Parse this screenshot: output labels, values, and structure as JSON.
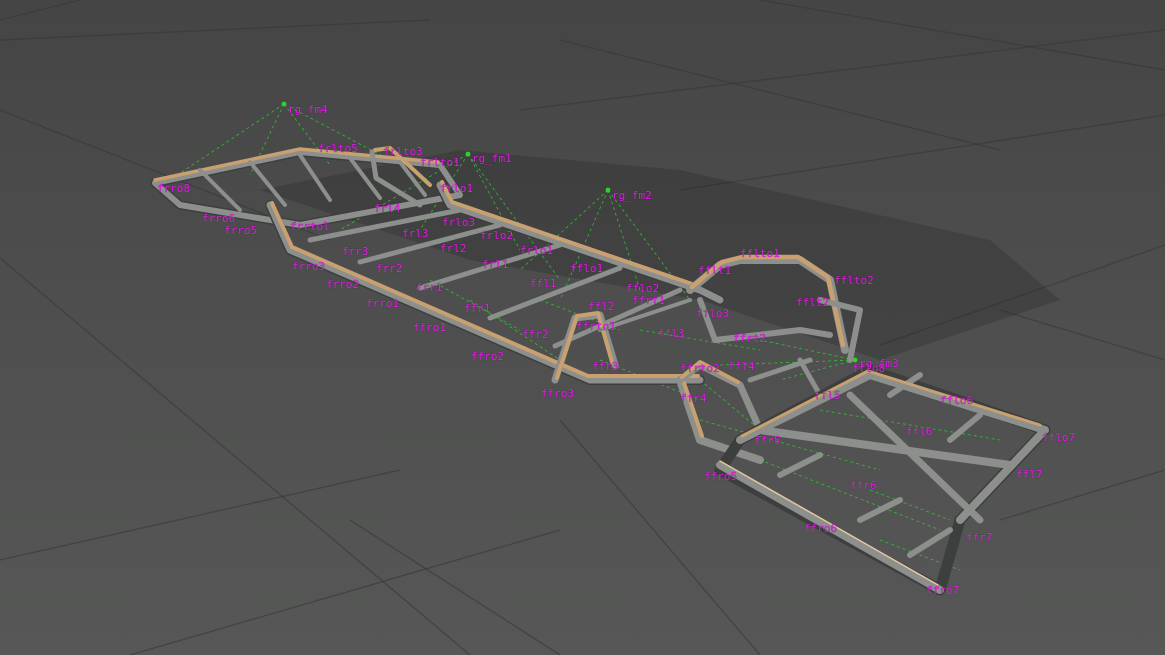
{
  "scene": {
    "colors": {
      "ground": "#4a4b4a",
      "label": "#e11ee6",
      "wire": "#2fd22f",
      "beam_orange": "#c9a070",
      "beam_grey": "#8c8f8c"
    }
  },
  "nodes": {
    "rg_fm4": "rg_fm4",
    "rg_fm1": "rg_fm1",
    "rg_fm2": "rg_fm2",
    "rg_fm3": "rg_fm3",
    "frlto5": "frlto5",
    "frlto3": "frlto3",
    "frlto1": "frlto1",
    "frlo1": "frlo1",
    "frlo3": "frlo3",
    "frlo2": "frlo2",
    "frlo1b": "frlo1",
    "frl1": "frl1",
    "frl2": "frl2",
    "frl3": "frl3",
    "frl4": "frl4",
    "frr1": "frr1",
    "frr2": "frr2",
    "frr3": "frr3",
    "frro1": "frro1",
    "frro2": "frro2",
    "frro3": "frro3",
    "frro5": "frro5",
    "frro6": "frro6",
    "frro8": "frro8",
    "frrtol": "frrtol",
    "ffrr1": "ffr1",
    "ffr2": "ffr2",
    "ffr3": "ffr3",
    "ffr4": "ffr4",
    "ffr5": "ffr5",
    "ffr6": "ffr6",
    "ffr7": "ffr7",
    "ffro1": "ffro1",
    "ffro2": "ffro2",
    "ffro3": "ffro3",
    "ffro5": "ffro5",
    "ffro6": "ffro6",
    "ffro7": "ffro7",
    "ffrto1": "ffrto1",
    "ffrto2": "ffrto2",
    "ffrt1": "ffrt1",
    "ffrt2": "ffrt2",
    "ffl1": "ffl1",
    "ffl2": "ffl2",
    "ffl3": "ffl3",
    "ffl4": "ffl4",
    "ffl5": "ffl5",
    "ffl6": "ffl6",
    "ffl7": "ffl7",
    "fflo1": "fflo1",
    "fflo2": "fflo2",
    "fflo3": "fflo3",
    "fflo6": "fflo6",
    "fflo7": "fflo7",
    "fflt1": "fflt1",
    "fflt2": "fflt2",
    "fflto1": "fflto1",
    "fflto2": "fflto2",
    "fflo8": "fflo8"
  }
}
